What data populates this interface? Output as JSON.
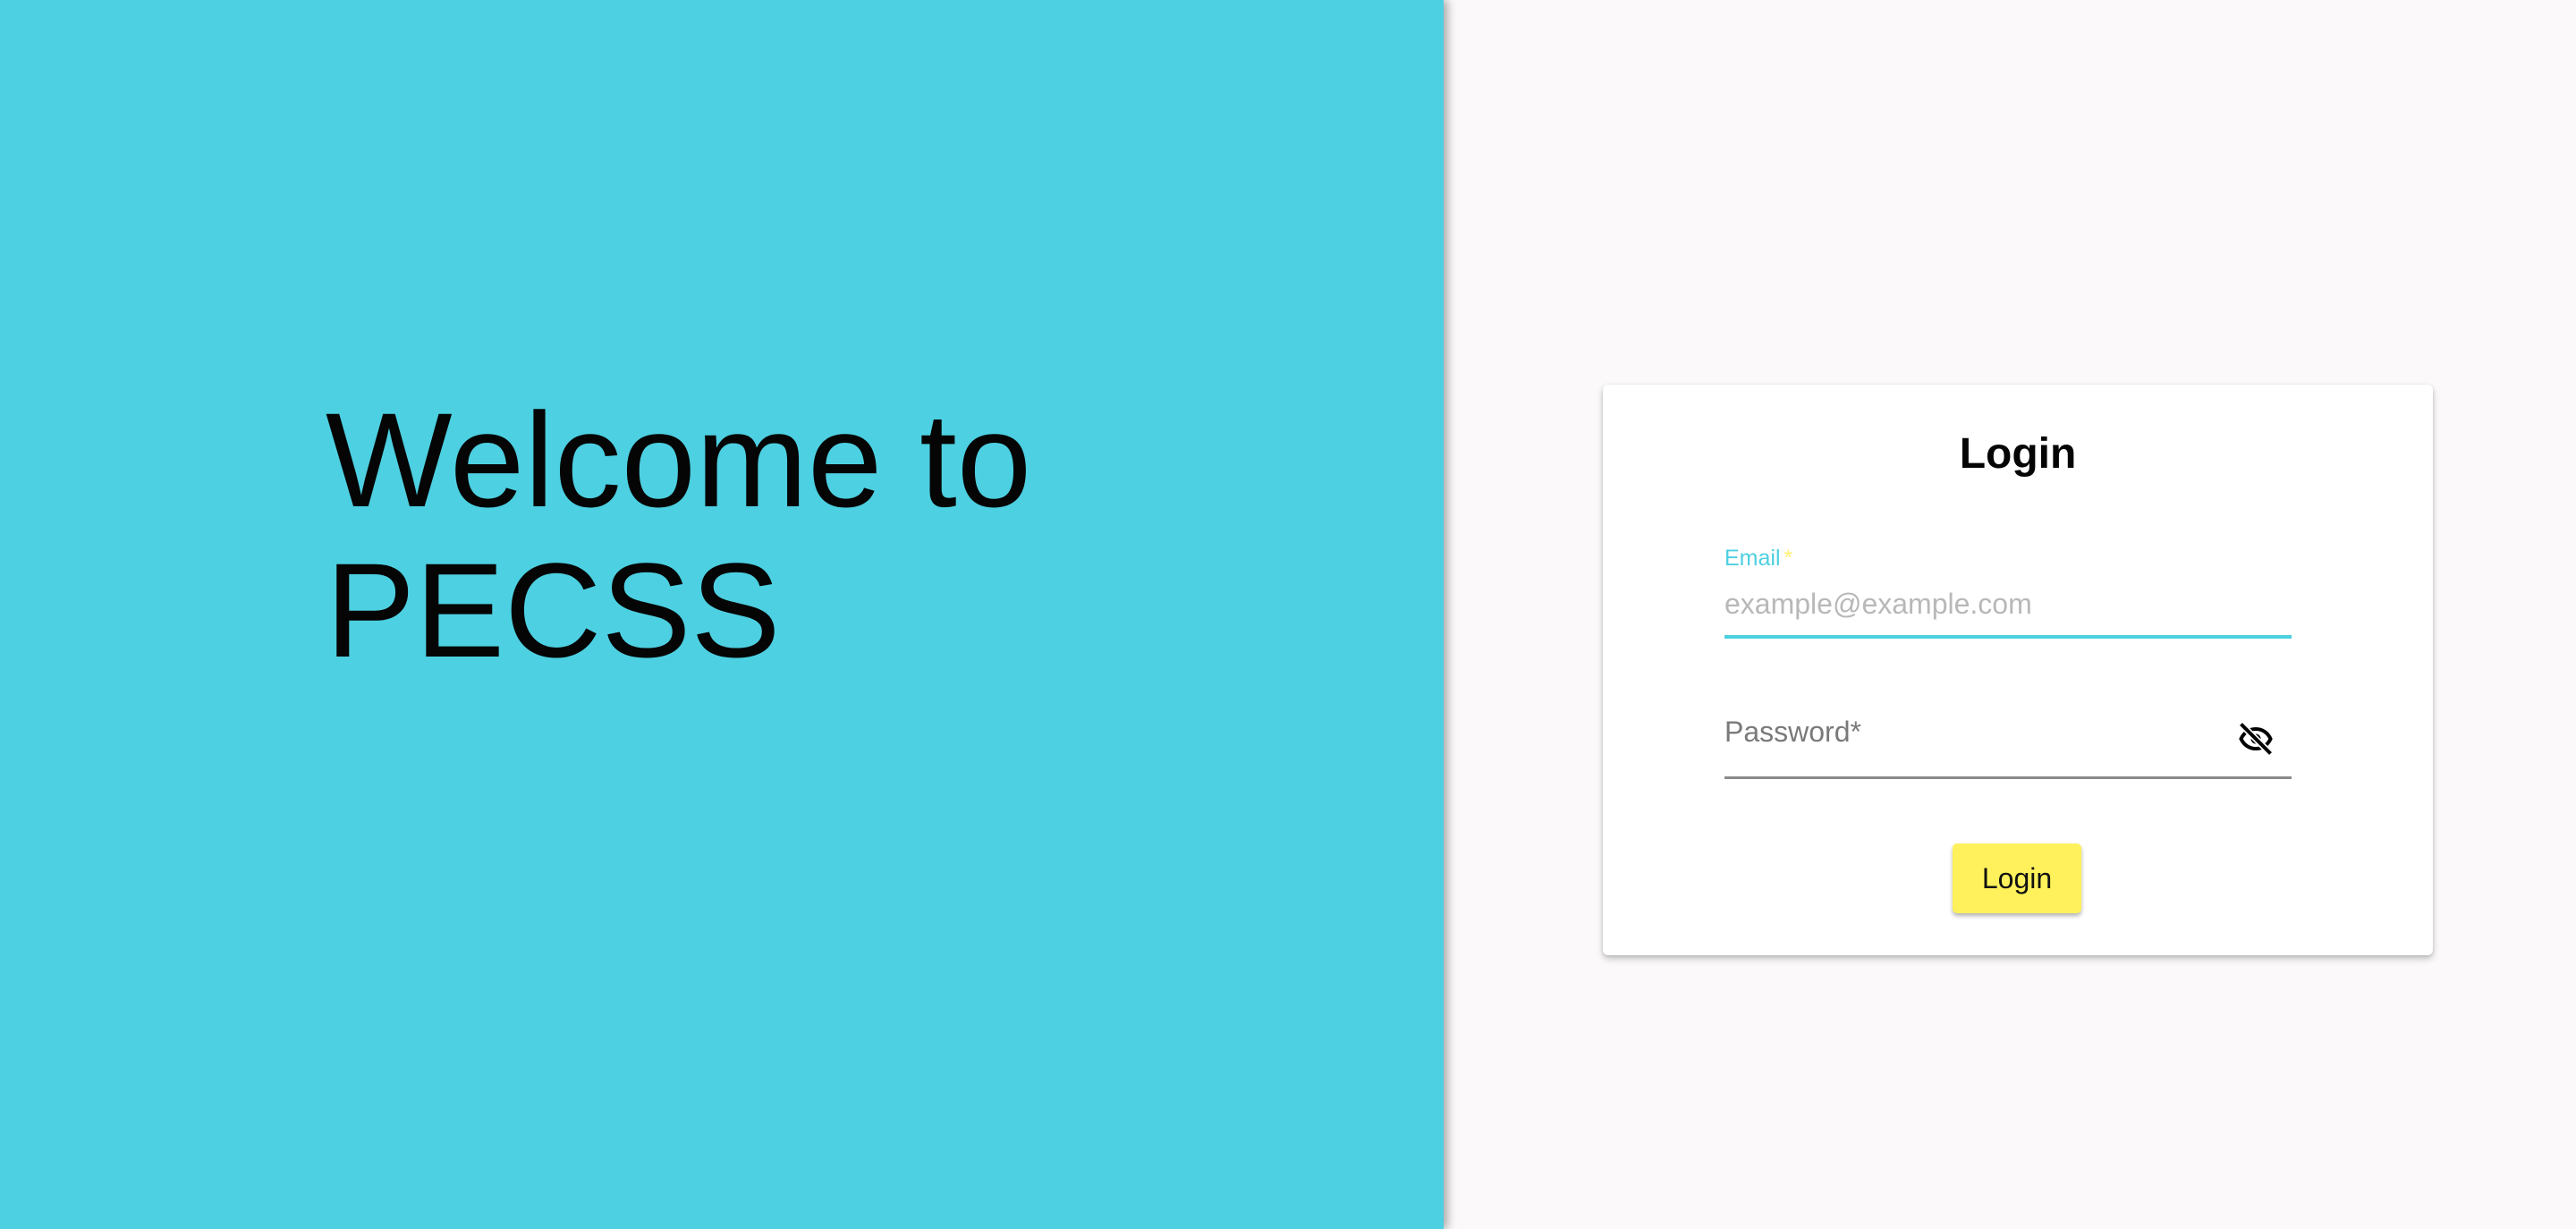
{
  "hero": {
    "line1": "Welcome to",
    "line2": "PECSS",
    "background_color": "#4dd0e1"
  },
  "login_card": {
    "title": "Login",
    "email": {
      "label": "Email",
      "required_marker": "*",
      "placeholder": "example@example.com",
      "value": ""
    },
    "password": {
      "label": "Password*",
      "visibility_icon": "eye-off-icon"
    },
    "submit_label": "Login"
  },
  "colors": {
    "accent": "#4dd0e1",
    "button": "#fff15b",
    "page_background": "#fbf9f9"
  }
}
